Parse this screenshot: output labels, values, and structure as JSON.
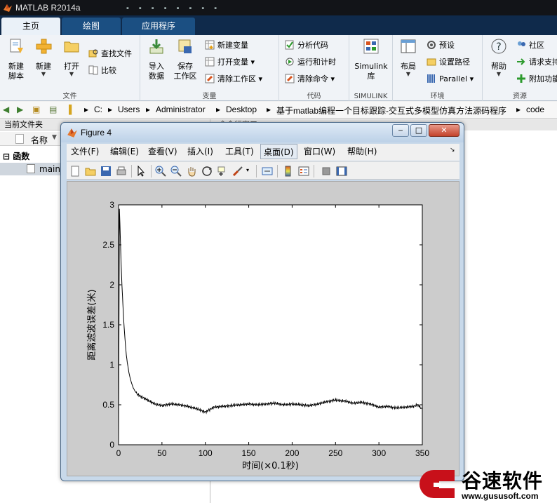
{
  "app": {
    "title": "MATLAB R2014a",
    "icon": "matlab-logo-icon"
  },
  "ribbon_tabs": [
    {
      "label": "主页",
      "active": true
    },
    {
      "label": "绘图",
      "active": false
    },
    {
      "label": "应用程序",
      "active": false
    }
  ],
  "ribbon": {
    "file": {
      "group_label": "文件",
      "new_script": "新建\n脚本",
      "new": "新建",
      "open": "打开",
      "find_files": "查找文件",
      "compare": "比较"
    },
    "variable": {
      "group_label": "变量",
      "import": "导入\n数据",
      "save_ws": "保存\n工作区",
      "new_var": "新建变量",
      "open_var": "打开变量",
      "clear_ws": "清除工作区"
    },
    "code": {
      "group_label": "代码",
      "analyze": "分析代码",
      "run_time": "运行和计时",
      "clear_cmd": "清除命令"
    },
    "simulink": {
      "group_label": "SIMULINK",
      "lib": "Simulink\n库"
    },
    "environment": {
      "group_label": "环境",
      "layout": "布局",
      "prefs": "预设",
      "set_path": "设置路径",
      "parallel": "Parallel"
    },
    "resources": {
      "group_label": "资源",
      "help": "帮助",
      "community": "社区",
      "request_support": "请求支持",
      "addons": "附加功能"
    }
  },
  "address_bar": {
    "crumbs": [
      "C:",
      "Users",
      "Administrator",
      "Desktop",
      "基于matlab编程一个目标跟踪-交互式多模型仿真方法源码程序",
      "code"
    ]
  },
  "current_folder": {
    "title": "当前文件夹",
    "column_name": "名称",
    "group": "函数",
    "file": "main"
  },
  "command_window": {
    "title": "命令行窗口"
  },
  "figure": {
    "title": "Figure 4",
    "menu": [
      "文件(F)",
      "编辑(E)",
      "查看(V)",
      "插入(I)",
      "工具(T)",
      "桌面(D)",
      "窗口(W)",
      "帮助(H)"
    ],
    "selected_menu": "桌面(D)"
  },
  "chart_data": {
    "type": "line",
    "title": "",
    "xlabel": "时间(×0.1秒)",
    "ylabel": "距离滤波误差(米)",
    "xlim": [
      0,
      350
    ],
    "ylim": [
      0,
      3
    ],
    "xticks": [
      0,
      50,
      100,
      150,
      200,
      250,
      300,
      350
    ],
    "yticks": [
      0,
      0.5,
      1,
      1.5,
      2,
      2.5,
      3
    ],
    "grid": false,
    "legend": "none",
    "color": "#000000",
    "series": [
      {
        "x": [
          0,
          1,
          2,
          3,
          4,
          5,
          6,
          7,
          8,
          9,
          10,
          11,
          12,
          13,
          14,
          15,
          17,
          19,
          21,
          23,
          25,
          28,
          30,
          35,
          40,
          45,
          50,
          55,
          60,
          70,
          80,
          90,
          95,
          100,
          105,
          110,
          120,
          130,
          140,
          150,
          160,
          170,
          180,
          190,
          200,
          210,
          220,
          230,
          240,
          250,
          255,
          260,
          270,
          280,
          290,
          300,
          310,
          320,
          330,
          340,
          345,
          350
        ],
        "y": [
          0.0,
          2.95,
          2.6,
          2.25,
          1.98,
          1.75,
          1.55,
          1.38,
          1.24,
          1.12,
          1.03,
          0.97,
          0.9,
          0.85,
          0.81,
          0.77,
          0.71,
          0.67,
          0.64,
          0.62,
          0.61,
          0.59,
          0.58,
          0.55,
          0.52,
          0.5,
          0.49,
          0.5,
          0.51,
          0.5,
          0.48,
          0.45,
          0.43,
          0.41,
          0.44,
          0.47,
          0.48,
          0.49,
          0.5,
          0.51,
          0.5,
          0.51,
          0.52,
          0.5,
          0.51,
          0.5,
          0.49,
          0.51,
          0.54,
          0.56,
          0.55,
          0.55,
          0.52,
          0.53,
          0.51,
          0.47,
          0.48,
          0.46,
          0.47,
          0.48,
          0.5,
          0.44
        ]
      }
    ]
  },
  "watermark": {
    "brand": "谷速软件",
    "url": "www.gususoft.com",
    "brand_color": "#c8101a"
  }
}
